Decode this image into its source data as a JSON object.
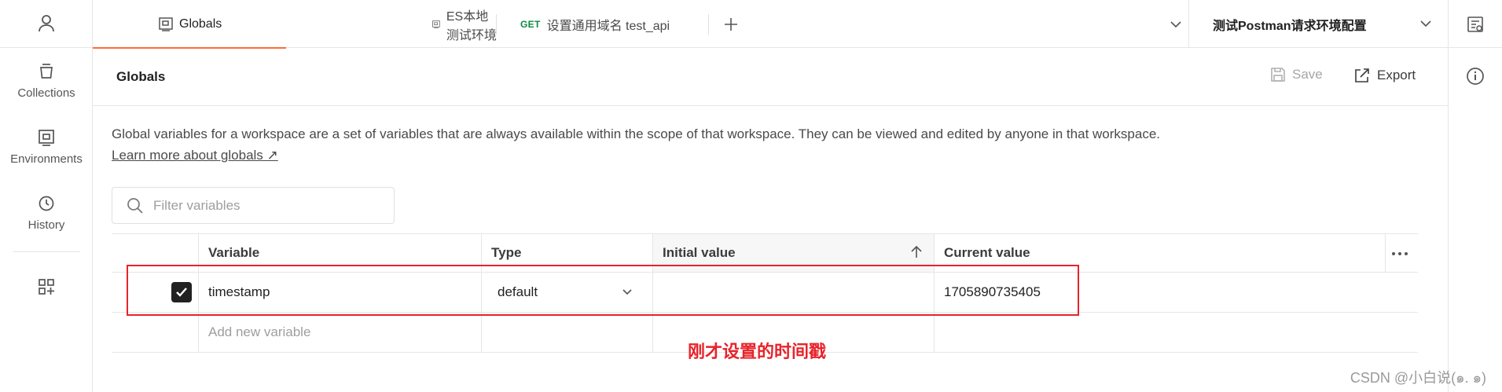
{
  "sidebar": {
    "items": [
      {
        "label": "Collections",
        "icon": "collections-icon"
      },
      {
        "label": "Environments",
        "icon": "environments-icon"
      },
      {
        "label": "History",
        "icon": "history-icon"
      }
    ]
  },
  "tabs": [
    {
      "label": "Globals",
      "active": true
    },
    {
      "label": "ES本地测试环境",
      "active": false
    },
    {
      "method": "GET",
      "label": "设置通用域名 test_api",
      "active": false
    }
  ],
  "environment_selector": {
    "value": "测试Postman请求环境配置"
  },
  "header": {
    "title": "Globals",
    "save_label": "Save",
    "export_label": "Export"
  },
  "description": {
    "text": "Global variables for a workspace are a set of variables that are always available within the scope of that workspace. They can be viewed and edited by anyone in that workspace.",
    "link": "Learn more about globals ↗"
  },
  "filter": {
    "placeholder": "Filter variables"
  },
  "table": {
    "columns": [
      "Variable",
      "Type",
      "Initial value",
      "Current value"
    ],
    "rows": [
      {
        "checked": true,
        "variable": "timestamp",
        "type": "default",
        "initial_value": "",
        "current_value": "1705890735405"
      }
    ],
    "add_placeholder": "Add new variable"
  },
  "annotation": "刚才设置的时间戳",
  "watermark": "CSDN @小白说(๑. ๑)",
  "colors": {
    "accent": "#ff6c37",
    "annotation_red": "#e8232a",
    "get_green": "#0a8a3c"
  }
}
